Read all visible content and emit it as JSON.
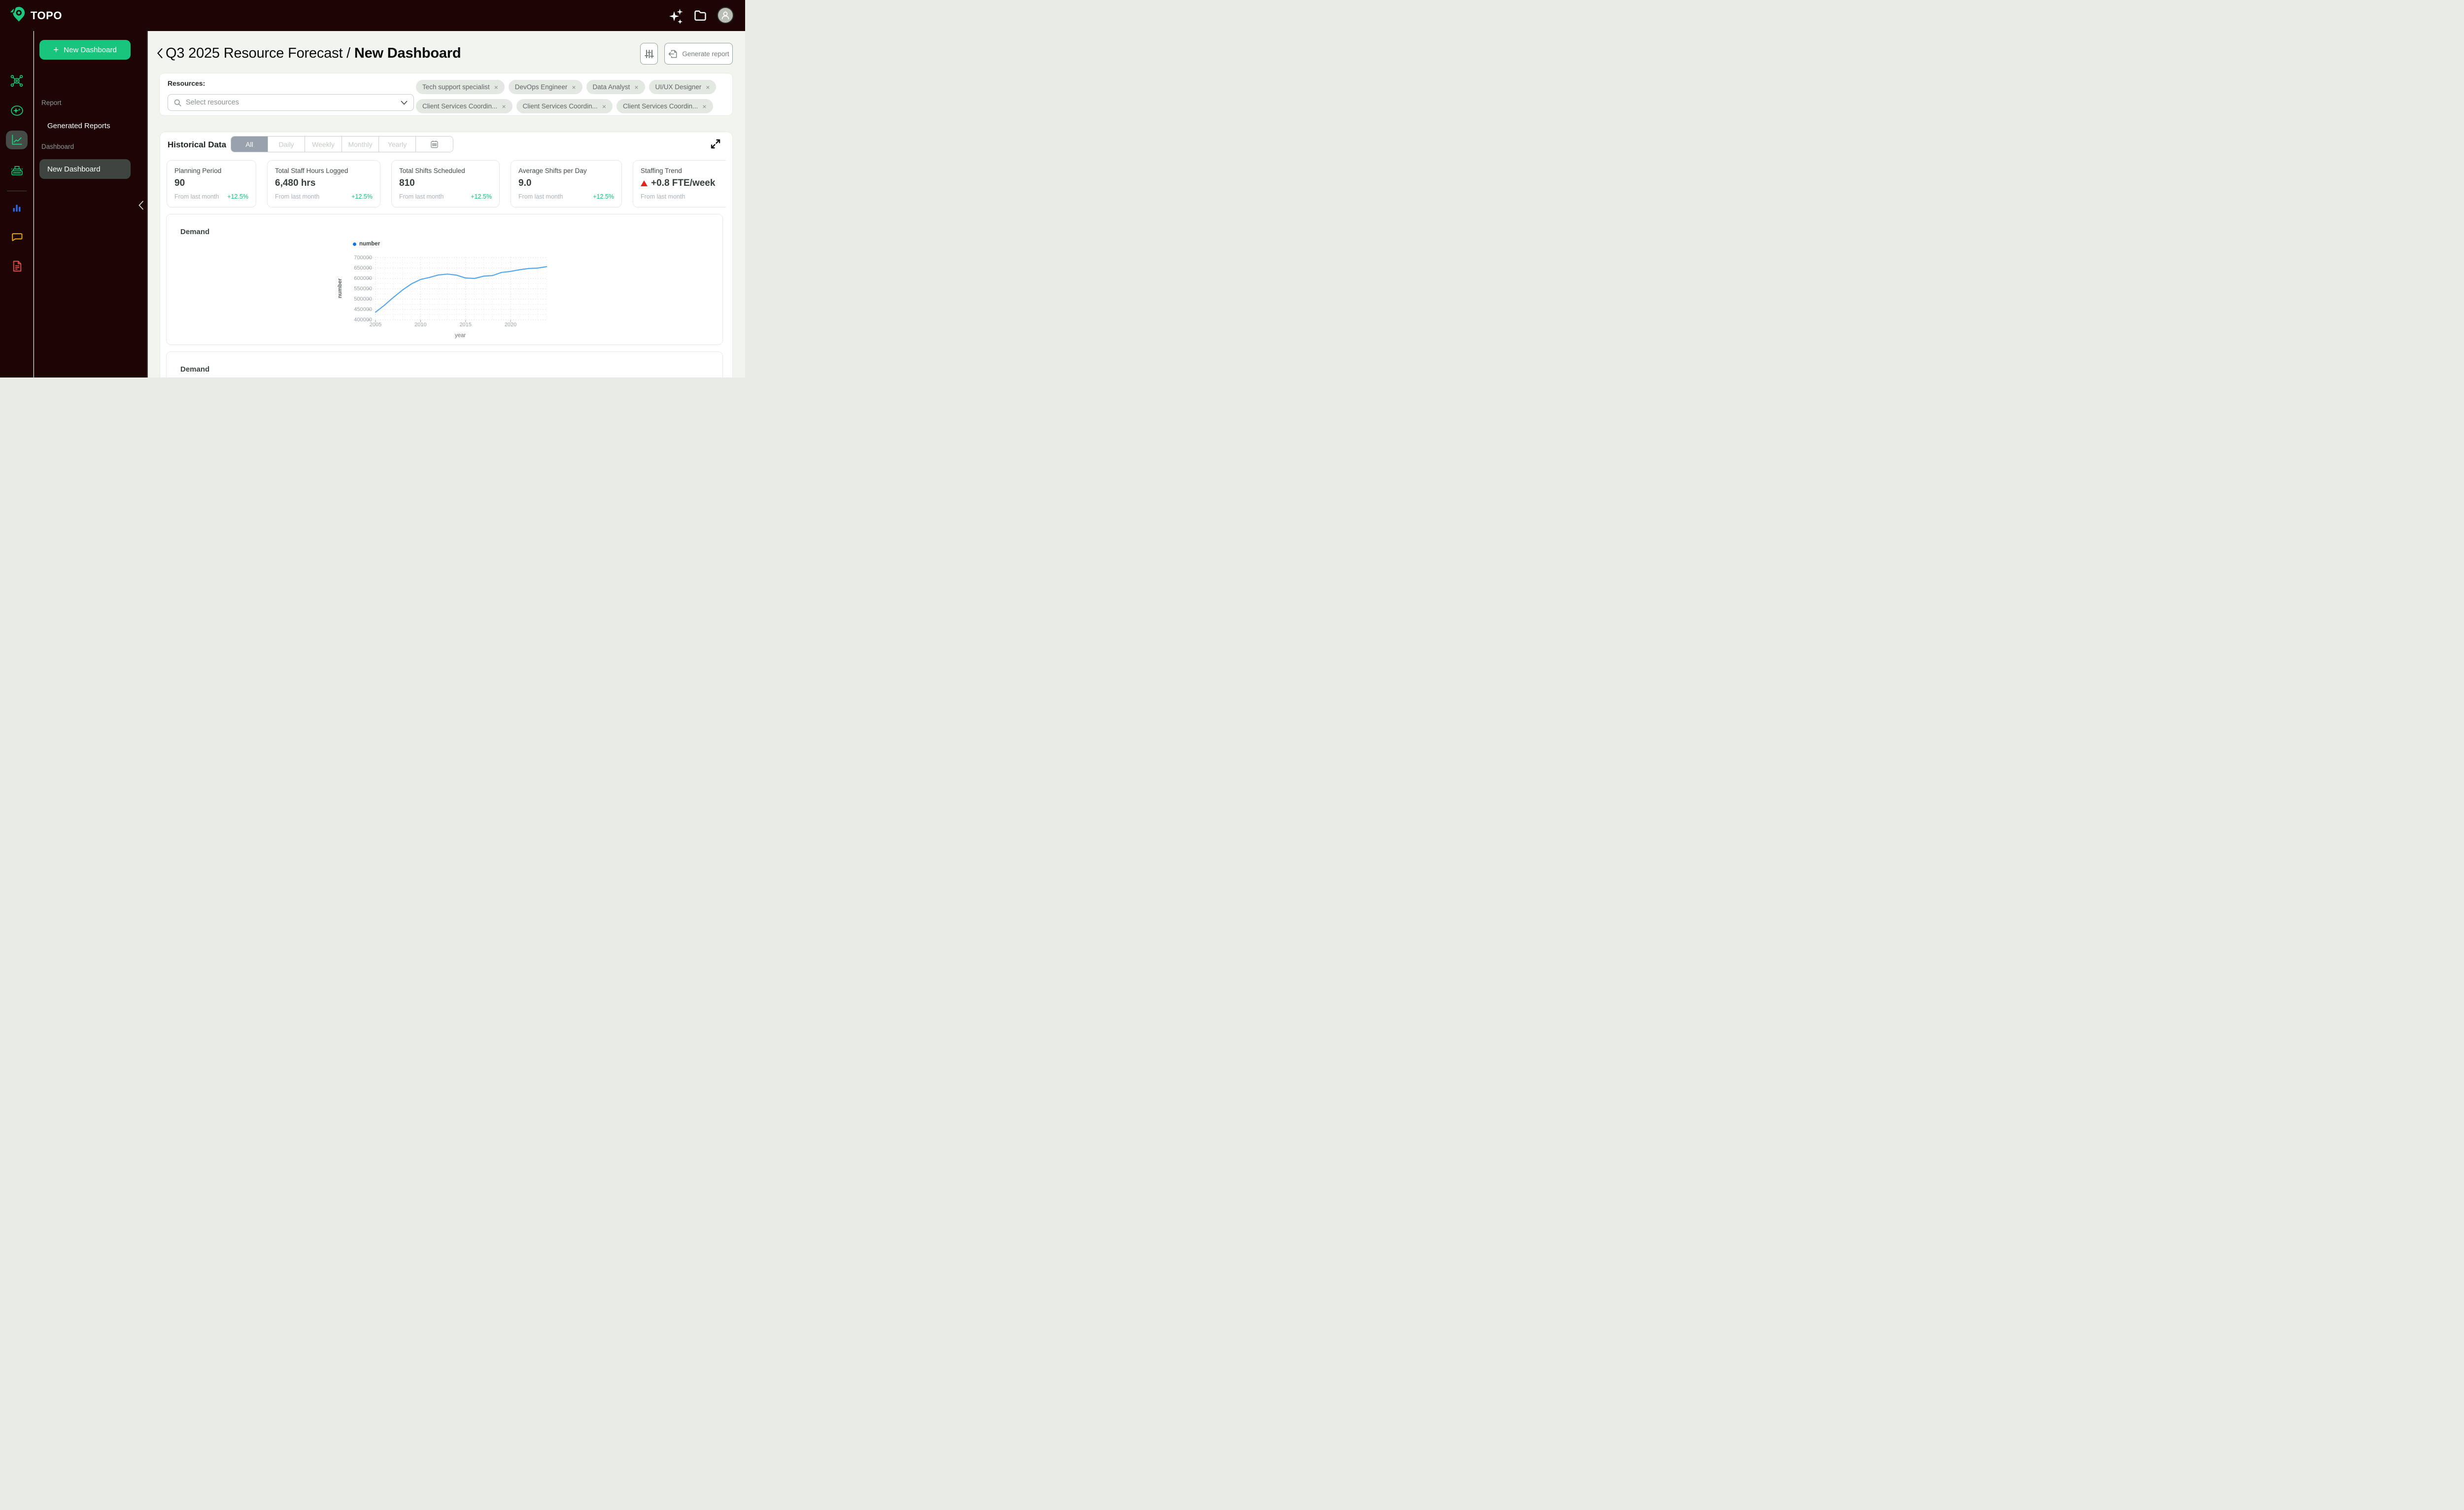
{
  "topbar": {
    "brand": "TOPO"
  },
  "sidebar": {
    "new_dashboard_label": "New Dashboard",
    "sections": [
      {
        "label": "Report",
        "items": [
          {
            "label": "Generated Reports",
            "selected": false
          }
        ]
      },
      {
        "label": "Dashboard",
        "items": [
          {
            "label": "New Dashboard",
            "selected": true
          }
        ]
      }
    ]
  },
  "breadcrumb": {
    "parent": "Q3 2025 Resource Forecast",
    "separator": " / ",
    "current": "New Dashboard"
  },
  "toolbar": {
    "generate_report_label": "Generate report"
  },
  "resources": {
    "label": "Resources:",
    "select_placeholder": "Select resources",
    "remove_symbol": "×",
    "tags_row1": [
      {
        "label": "Tech support specialist"
      },
      {
        "label": "DevOps Engineer"
      },
      {
        "label": "Data Analyst"
      },
      {
        "label": "UI/UX Designer"
      }
    ],
    "tags_row2": [
      {
        "label": "Client Services Coordin..."
      },
      {
        "label": "Client Services Coordin..."
      },
      {
        "label": "Client Services Coordin..."
      }
    ]
  },
  "historical": {
    "title": "Historical Data",
    "tabs": [
      {
        "label": "All",
        "selected": true
      },
      {
        "label": "Daily",
        "selected": false
      },
      {
        "label": "Weekly",
        "selected": false
      },
      {
        "label": "Monthly",
        "selected": false
      },
      {
        "label": "Yearly",
        "selected": false
      }
    ],
    "stats": [
      {
        "title": "Planning Period",
        "value": "90",
        "footer_left": "From last month",
        "footer_right": "+12.5%"
      },
      {
        "title": "Total Staff Hours Logged",
        "value": "6,480 hrs",
        "footer_left": "From last month",
        "footer_right": "+12.5%"
      },
      {
        "title": "Total Shifts Scheduled",
        "value": "810",
        "footer_left": "From last month",
        "footer_right": "+12.5%"
      },
      {
        "title": "Average Shifts per Day",
        "value": "9.0",
        "footer_left": "From last month",
        "footer_right": "+12.5%"
      },
      {
        "title": "Staffing Trend",
        "value": "+0.8 FTE/week",
        "footer_left": "From last month",
        "footer_right": "",
        "trend_icon": "red-triangle-up"
      }
    ]
  },
  "demand_card": {
    "title": "Demand"
  },
  "demand_card_2": {
    "title": "Demand"
  },
  "chart_data": {
    "type": "line",
    "title": "Demand",
    "xlabel": "year",
    "ylabel": "number",
    "legend_position": "top",
    "grid": "dashed",
    "xlim": [
      2005,
      2024
    ],
    "ylim": [
      400000,
      700000
    ],
    "xticks": [
      2005,
      2010,
      2015,
      2020
    ],
    "yticks": [
      700000,
      650000,
      600000,
      550000,
      500000,
      450000,
      400000
    ],
    "series": [
      {
        "name": "number",
        "color": "#57a7ea",
        "x": [
          2005,
          2006,
          2007,
          2008,
          2009,
          2010,
          2011,
          2012,
          2013,
          2014,
          2015,
          2016,
          2017,
          2018,
          2019,
          2020,
          2021,
          2022,
          2023,
          2024
        ],
        "values": [
          437000,
          471000,
          509000,
          544000,
          574000,
          595000,
          605000,
          617000,
          621000,
          616000,
          602000,
          600000,
          611000,
          614000,
          629000,
          634000,
          642000,
          648000,
          650000,
          657000
        ]
      }
    ]
  },
  "colors": {
    "accent_green": "#19c47c",
    "dark_bg": "#1d0506",
    "selected_tab_bg": "#99a1ad",
    "positive_green": "#15c072",
    "trend_red": "#e3241b",
    "line_blue": "#57a7ea",
    "legend_dot_blue": "#1673e6"
  }
}
